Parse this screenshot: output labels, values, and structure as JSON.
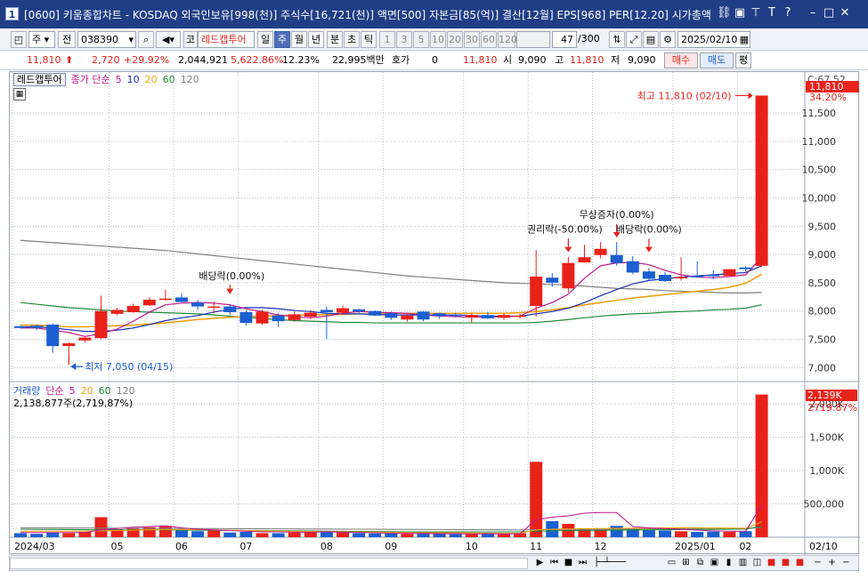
{
  "window": {
    "number": "1",
    "title": "[0600] 키움종합차트 - KOSDAQ 외국인보유[998(천)] 주식수[16,721(천)] 액면[500] 자본금[85(억)] 결산[12월] EPS[968] PER[12.20] 시가총액"
  },
  "toolbar": {
    "period_type": "주",
    "prev_label": "전",
    "code": "038390",
    "indicator_prefix": "코",
    "stock_name": "레드캡투어",
    "periods": [
      "일",
      "주",
      "월",
      "년",
      "분",
      "초",
      "틱"
    ],
    "active_period": "주",
    "intervals": [
      "1",
      "3",
      "5",
      "10",
      "20",
      "30",
      "60",
      "120"
    ],
    "count": "47",
    "count_total": "/300",
    "date": "2025/02/10"
  },
  "quote": {
    "price": "11,810",
    "change": "2,720",
    "change_pct": "+29.92%",
    "volume": "2,044,921",
    "volume_ratio": "5,622.86%",
    "turnover": "12.23%",
    "amount": "22,995백만",
    "bid_label": "호가",
    "bid_value": "0",
    "bid_price": "11,810",
    "open_label": "시",
    "open": "9,090",
    "high_label": "고",
    "high": "11,810",
    "low_label": "저",
    "low": "9,090",
    "buy_label": "매수",
    "sell_label": "매도",
    "avg_label": "평"
  },
  "legend": {
    "stock": "레드캡투어",
    "ma_label": "종가 단순",
    "ma_periods": [
      "5",
      "10",
      "20",
      "60",
      "120"
    ],
    "volume_label": "거래량",
    "volume_ma_label": "단순",
    "volume_ma_periods": [
      "5",
      "20",
      "60",
      "120"
    ],
    "volume_value": "2,138,877주(2,719,87%)"
  },
  "colors": {
    "up": "#e8221a",
    "down": "#1b5fd1",
    "ma5": "#c0188c",
    "ma10": "#1a2fb0",
    "ma20": "#f0a010",
    "ma60": "#1e8a3a",
    "ma120": "#808080",
    "grid": "#b8c0cc"
  },
  "annotations": {
    "high": "최고 11,810 (02/10)",
    "low": "최저 7,050 (04/15)",
    "dividend1": "배당락(0.00%)",
    "rights": "권리락(-50.00%)",
    "bonus": "무상증자(0.00%)",
    "dividend2": "배당락(0.00%)"
  },
  "right_labels": {
    "close_ratio": "C:67.52",
    "current": "11,810",
    "current_pct": "34.20%",
    "vol_current": "2,139K",
    "vol_pct": "2719.87%"
  },
  "chart_data": [
    {
      "type": "candlestick",
      "title": "",
      "ylim": [
        6800,
        12100
      ],
      "y_ticks": [
        {
          "v": 7000,
          "label": "7,000"
        },
        {
          "v": 7500,
          "label": "7,500"
        },
        {
          "v": 8000,
          "label": "8,000"
        },
        {
          "v": 8500,
          "label": "8,500"
        },
        {
          "v": 9000,
          "label": "9,000"
        },
        {
          "v": 9500,
          "label": "9,500"
        },
        {
          "v": 10000,
          "label": "10,000"
        },
        {
          "v": 10500,
          "label": "10,500"
        },
        {
          "v": 11000,
          "label": "11,000"
        },
        {
          "v": 11500,
          "label": "11,500"
        }
      ],
      "x_labels": [
        {
          "i": 0,
          "label": "2024/03"
        },
        {
          "i": 6,
          "label": "05"
        },
        {
          "i": 10,
          "label": "06"
        },
        {
          "i": 14,
          "label": "07"
        },
        {
          "i": 19,
          "label": "08"
        },
        {
          "i": 23,
          "label": "09"
        },
        {
          "i": 28,
          "label": "10"
        },
        {
          "i": 32,
          "label": "11"
        },
        {
          "i": 36,
          "label": "12"
        },
        {
          "i": 41,
          "label": "2025/01"
        },
        {
          "i": 45,
          "label": "02"
        }
      ],
      "candles": [
        [
          7730,
          7750,
          7690,
          7700
        ],
        [
          7740,
          7760,
          7660,
          7700
        ],
        [
          7760,
          7780,
          7260,
          7380
        ],
        [
          7380,
          7450,
          7050,
          7430
        ],
        [
          7480,
          7560,
          7440,
          7530
        ],
        [
          7520,
          8270,
          7500,
          8000
        ],
        [
          7950,
          8060,
          7920,
          8020
        ],
        [
          7980,
          8130,
          7970,
          8090
        ],
        [
          8100,
          8240,
          8090,
          8200
        ],
        [
          8200,
          8380,
          8180,
          8220
        ],
        [
          8240,
          8310,
          8150,
          8160
        ],
        [
          8150,
          8200,
          8020,
          8080
        ],
        [
          8080,
          8170,
          7960,
          8080
        ],
        [
          8080,
          8120,
          7930,
          7980
        ],
        [
          7980,
          8010,
          7740,
          7790
        ],
        [
          7780,
          8020,
          7760,
          7990
        ],
        [
          7920,
          7970,
          7720,
          7820
        ],
        [
          7840,
          7990,
          7810,
          7940
        ],
        [
          7900,
          8020,
          7860,
          7970
        ],
        [
          8020,
          8080,
          7510,
          7980
        ],
        [
          7970,
          8100,
          7940,
          8050
        ],
        [
          8030,
          8040,
          7960,
          7990
        ],
        [
          8000,
          8010,
          7910,
          7920
        ],
        [
          7960,
          7990,
          7840,
          7880
        ],
        [
          7850,
          7970,
          7810,
          7920
        ],
        [
          7990,
          8000,
          7820,
          7850
        ],
        [
          7960,
          7970,
          7860,
          7910
        ],
        [
          7940,
          7970,
          7890,
          7910
        ],
        [
          7890,
          7960,
          7800,
          7930
        ],
        [
          7930,
          7980,
          7860,
          7870
        ],
        [
          7880,
          7960,
          7840,
          7930
        ],
        [
          7900,
          7950,
          7870,
          7920
        ],
        [
          8090,
          9080,
          7900,
          8610
        ],
        [
          8590,
          8670,
          8430,
          8500
        ],
        [
          8400,
          8960,
          8330,
          8850
        ],
        [
          8860,
          9170,
          8850,
          8950
        ],
        [
          8990,
          9220,
          8930,
          9100
        ],
        [
          8990,
          9220,
          8800,
          8850
        ],
        [
          8880,
          8970,
          8650,
          8680
        ],
        [
          8700,
          8760,
          8540,
          8570
        ],
        [
          8640,
          8690,
          8510,
          8530
        ],
        [
          8580,
          8950,
          8540,
          8600
        ],
        [
          8620,
          8880,
          8590,
          8610
        ],
        [
          8640,
          8720,
          8560,
          8620
        ],
        [
          8620,
          8740,
          8600,
          8740
        ],
        [
          8770,
          8790,
          8700,
          8740
        ],
        [
          8800,
          11810,
          8780,
          11810
        ]
      ],
      "ma_series": {
        "ma5": [
          7700,
          7700,
          7660,
          7620,
          7550,
          7600,
          7680,
          7820,
          7980,
          8110,
          8140,
          8150,
          8140,
          8110,
          8040,
          7990,
          7930,
          7900,
          7880,
          7910,
          7960,
          7990,
          7980,
          7970,
          7960,
          7930,
          7910,
          7900,
          7890,
          7890,
          7900,
          7910,
          8050,
          8150,
          8300,
          8580,
          8800,
          8850,
          8860,
          8820,
          8720,
          8640,
          8600,
          8590,
          8610,
          8640,
          8950
        ],
        "ma10": [
          7720,
          7720,
          7700,
          7670,
          7640,
          7640,
          7660,
          7700,
          7760,
          7830,
          7880,
          7920,
          7980,
          8030,
          8060,
          8060,
          8040,
          8010,
          7990,
          7960,
          7950,
          7950,
          7940,
          7930,
          7930,
          7930,
          7930,
          7930,
          7920,
          7910,
          7910,
          7910,
          7950,
          7990,
          8050,
          8150,
          8270,
          8380,
          8480,
          8540,
          8570,
          8600,
          8620,
          8640,
          8660,
          8680,
          8800
        ],
        "ma20": [
          7750,
          7750,
          7740,
          7720,
          7720,
          7730,
          7740,
          7750,
          7770,
          7790,
          7820,
          7850,
          7870,
          7890,
          7900,
          7910,
          7920,
          7930,
          7930,
          7940,
          7940,
          7950,
          7950,
          7960,
          7960,
          7960,
          7960,
          7960,
          7960,
          7960,
          7960,
          7970,
          7990,
          8020,
          8060,
          8110,
          8150,
          8190,
          8230,
          8260,
          8290,
          8320,
          8350,
          8380,
          8420,
          8490,
          8650
        ],
        "ma60": [
          8150,
          8120,
          8090,
          8060,
          8040,
          8020,
          8000,
          7990,
          7980,
          7970,
          7960,
          7950,
          7930,
          7910,
          7890,
          7870,
          7850,
          7830,
          7820,
          7810,
          7800,
          7800,
          7790,
          7790,
          7790,
          7790,
          7790,
          7790,
          7790,
          7790,
          7790,
          7790,
          7800,
          7820,
          7850,
          7880,
          7910,
          7930,
          7950,
          7960,
          7980,
          7990,
          8000,
          8020,
          8030,
          8050,
          8110
        ],
        "ma120": [
          9250,
          9230,
          9210,
          9190,
          9170,
          9150,
          9130,
          9110,
          9090,
          9070,
          9040,
          9010,
          8980,
          8950,
          8920,
          8890,
          8860,
          8830,
          8800,
          8770,
          8740,
          8710,
          8680,
          8650,
          8620,
          8600,
          8580,
          8560,
          8540,
          8520,
          8500,
          8490,
          8480,
          8470,
          8460,
          8440,
          8420,
          8400,
          8390,
          8380,
          8360,
          8350,
          8340,
          8330,
          8320,
          8320,
          8330
        ]
      }
    },
    {
      "type": "bar",
      "title": "거래량",
      "ylim": [
        0,
        2200
      ],
      "y_ticks": [
        {
          "v": 500,
          "label": "500,000"
        },
        {
          "v": 1000,
          "label": "1,000K"
        },
        {
          "v": 1500,
          "label": "1,500K"
        },
        {
          "v": 2000,
          "label": "2,000K"
        }
      ],
      "values_k": [
        60,
        50,
        70,
        60,
        80,
        300,
        120,
        130,
        150,
        170,
        110,
        90,
        100,
        70,
        80,
        60,
        60,
        70,
        80,
        90,
        70,
        60,
        55,
        55,
        50,
        60,
        50,
        45,
        50,
        55,
        45,
        60,
        1130,
        240,
        200,
        120,
        110,
        170,
        140,
        110,
        100,
        90,
        80,
        85,
        80,
        90,
        2139
      ],
      "ma5": [
        70,
        70,
        70,
        70,
        70,
        110,
        130,
        150,
        160,
        170,
        140,
        120,
        110,
        100,
        90,
        80,
        80,
        75,
        75,
        80,
        75,
        70,
        65,
        60,
        58,
        56,
        53,
        52,
        50,
        52,
        50,
        52,
        260,
        300,
        320,
        360,
        370,
        370,
        160,
        140,
        130,
        120,
        105,
        95,
        90,
        87,
        480
      ],
      "ma20": [
        90,
        90,
        90,
        90,
        90,
        95,
        100,
        105,
        110,
        115,
        115,
        115,
        110,
        105,
        100,
        95,
        90,
        88,
        85,
        82,
        80,
        78,
        75,
        72,
        70,
        68,
        66,
        64,
        62,
        60,
        58,
        58,
        110,
        120,
        125,
        128,
        130,
        132,
        135,
        138,
        140,
        142,
        140,
        138,
        136,
        134,
        230
      ],
      "ma60": [
        120,
        118,
        116,
        114,
        112,
        110,
        110,
        110,
        110,
        110,
        108,
        106,
        104,
        102,
        100,
        98,
        96,
        94,
        92,
        90,
        88,
        86,
        84,
        82,
        80,
        80,
        80,
        80,
        80,
        80,
        80,
        80,
        90,
        95,
        100,
        102,
        104,
        106,
        108,
        110,
        112,
        114,
        116,
        118,
        120,
        122,
        160
      ],
      "ma120": [
        140,
        140,
        139,
        138,
        137,
        136,
        135,
        134,
        133,
        132,
        131,
        130,
        129,
        128,
        127,
        126,
        125,
        124,
        123,
        122,
        121,
        120,
        119,
        118,
        117,
        116,
        115,
        114,
        113,
        112,
        111,
        110,
        112,
        114,
        116,
        118,
        120,
        122,
        124,
        126,
        128,
        130,
        131,
        132,
        133,
        134,
        145
      ]
    }
  ]
}
